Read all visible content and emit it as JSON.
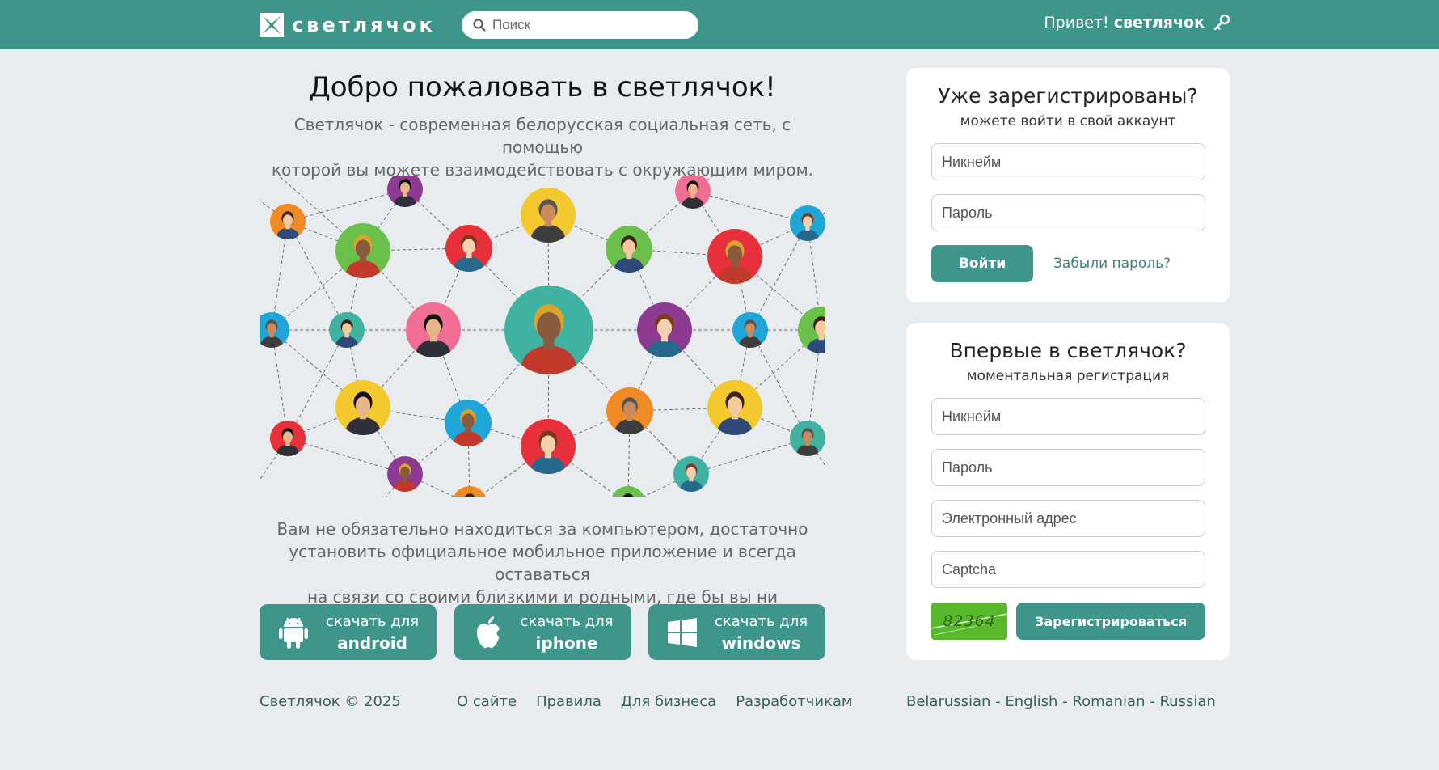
{
  "header": {
    "logo_text": "светлячок",
    "search_placeholder": "Поиск",
    "greeting_prefix": "Привет!",
    "greeting_user": "светлячок"
  },
  "welcome": {
    "title": "Добро пожаловать в светлячок!",
    "subtitle_line1": "Светлячок - современная белорусская социальная сеть, с помощью",
    "subtitle_line2": "которой вы можете взаимодействовать с окружающим миром.",
    "mobile_line1": "Вам не обязательно находиться за компьютером, достаточно",
    "mobile_line2": "установить официальное мобильное приложение и всегда оставаться",
    "mobile_line3": "на связи со своими близкими и родными, где бы вы ни находились."
  },
  "downloads": [
    {
      "line1": "скачать для",
      "line2": "android",
      "icon": "android-icon"
    },
    {
      "line1": "скачать для",
      "line2": "iphone",
      "icon": "apple-icon"
    },
    {
      "line1": "скачать для",
      "line2": "windows",
      "icon": "windows-icon"
    }
  ],
  "login": {
    "title": "Уже зарегистрированы?",
    "subtitle": "можете войти в свой аккаунт",
    "nickname_placeholder": "Никнейм",
    "password_placeholder": "Пароль",
    "submit_label": "Войти",
    "forgot_label": "Забыли пароль?"
  },
  "register": {
    "title": "Впервые в светлячок?",
    "subtitle": "моментальная регистрация",
    "nickname_placeholder": "Никнейм",
    "password_placeholder": "Пароль",
    "email_placeholder": "Электронный адрес",
    "captcha_placeholder": "Captcha",
    "captcha_code": "82364",
    "submit_label": "Зарегистрироваться"
  },
  "footer": {
    "copyright": "Светлячок © 2025",
    "links": [
      "О сайте",
      "Правила",
      "Для бизнеса",
      "Разработчикам"
    ],
    "languages": [
      "Belarussian",
      "English",
      "Romanian",
      "Russian"
    ],
    "language_separator": " - "
  },
  "colors": {
    "brand": "#3e9589",
    "background": "#e9ecef",
    "captcha": "#58b82b"
  }
}
